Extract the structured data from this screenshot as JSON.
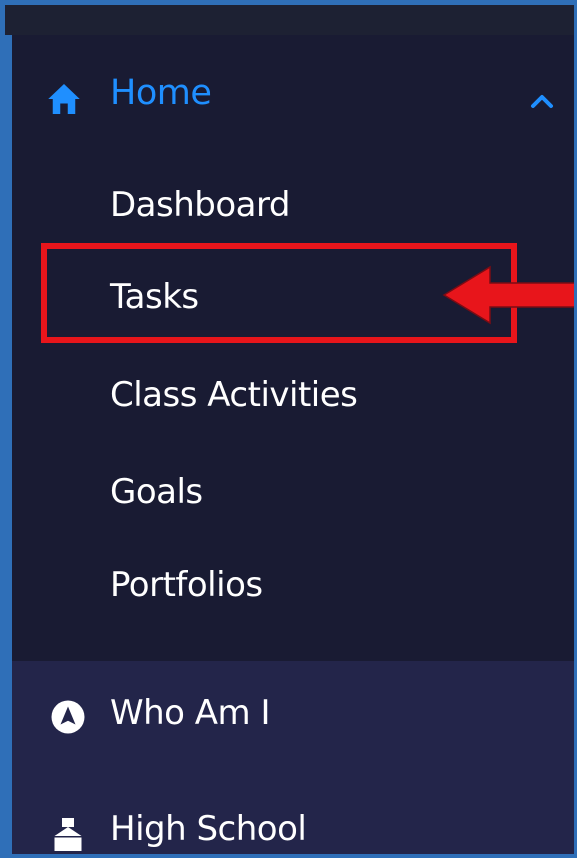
{
  "sidebar": {
    "home": {
      "label": "Home",
      "icon": "home-icon",
      "expanded": true,
      "subitems": [
        {
          "label": "Dashboard"
        },
        {
          "label": "Tasks"
        },
        {
          "label": "Class Activities"
        },
        {
          "label": "Goals"
        },
        {
          "label": "Portfolios"
        }
      ]
    },
    "items": [
      {
        "label": "Who Am I",
        "icon": "compass-icon"
      },
      {
        "label": "High School",
        "icon": "school-building-icon"
      }
    ]
  },
  "annotation": {
    "highlight_target": "Tasks",
    "highlight_color": "#e8151b",
    "arrow_color": "#e8151b"
  },
  "colors": {
    "accent": "#1f8fff",
    "sidebar_bg": "#191b33",
    "lower_bg": "#23254a",
    "frame": "#2f6fb8"
  }
}
